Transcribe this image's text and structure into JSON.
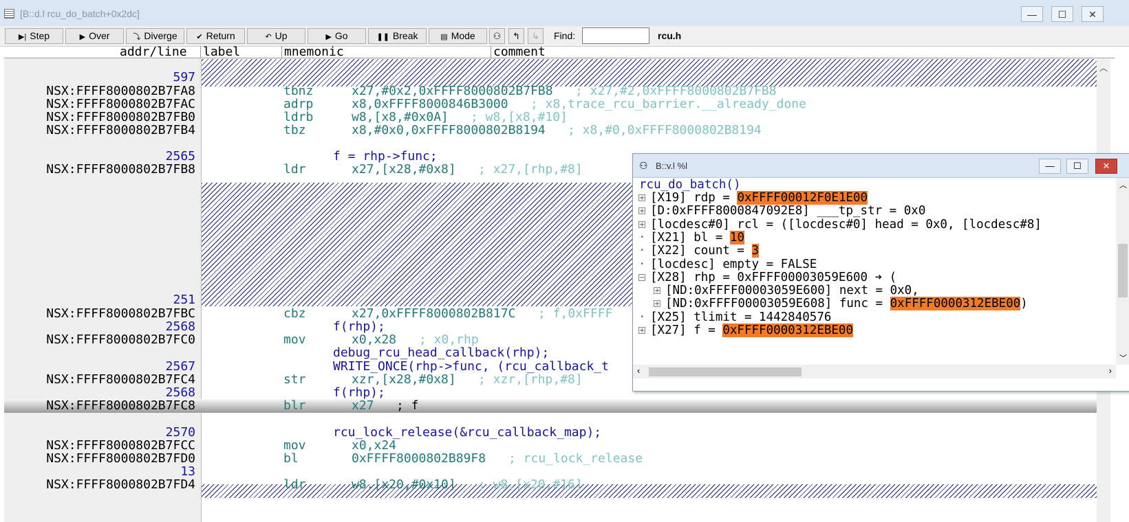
{
  "window": {
    "title": "[B::d.l rcu_do_batch+0x2dc]"
  },
  "toolbar": {
    "buttons": [
      {
        "icon": "▶|",
        "label": "Step"
      },
      {
        "icon": "▶",
        "label": "Over"
      },
      {
        "icon": "⤵",
        "label": "Diverge"
      },
      {
        "icon": "✔",
        "label": "Return"
      },
      {
        "icon": "↶",
        "label": "Up"
      },
      {
        "icon": "▶",
        "label": "Go"
      },
      {
        "icon": "❚❚",
        "label": "Break"
      },
      {
        "icon": "",
        "label": "Mode"
      }
    ],
    "find_label": "Find:",
    "find_value": "",
    "file": "rcu.h"
  },
  "columns": {
    "addr": "addr/line",
    "label": "label",
    "mnemonic": "mnemonic",
    "comment": "comment"
  },
  "listing": [
    {
      "kind": "line",
      "addr": "597"
    },
    {
      "kind": "ins",
      "addr": "NSX:FFFF8000802B7FA8",
      "mnem": "tbnz",
      "ops": "x27,#0x2,0xFFFF8000802B7FB8",
      "comment": "; x27,#2,0xFFFF8000802B7FB8"
    },
    {
      "kind": "ins",
      "addr": "NSX:FFFF8000802B7FAC",
      "mnem": "adrp",
      "ops": "x8,0xFFFF8000846B3000",
      "comment": "; x8,trace_rcu_barrier.__already_done"
    },
    {
      "kind": "ins",
      "addr": "NSX:FFFF8000802B7FB0",
      "mnem": "ldrb",
      "ops": "w8,[x8,#0x0A]",
      "comment": "; w8,[x8,#10]"
    },
    {
      "kind": "ins",
      "addr": "NSX:FFFF8000802B7FB4",
      "mnem": "tbz",
      "ops": "x8,#0x0,0xFFFF8000802B8194",
      "comment": "; x8,#0,0xFFFF8000802B8194"
    },
    {
      "kind": "line",
      "addr": "2565",
      "src": "f = rhp->func;"
    },
    {
      "kind": "ins",
      "addr": "NSX:FFFF8000802B7FB8",
      "mnem": "ldr",
      "ops": "x27,[x28,#0x8]",
      "comment": "; x27,[rhp,#8]"
    },
    {
      "kind": "line",
      "addr": "251"
    },
    {
      "kind": "ins",
      "addr": "NSX:FFFF8000802B7FBC",
      "mnem": "cbz",
      "ops": "x27,0xFFFF8000802B817C",
      "comment": "; f,0xFFFF"
    },
    {
      "kind": "line",
      "addr": "2568",
      "src": "f(rhp);"
    },
    {
      "kind": "ins",
      "addr": "NSX:FFFF8000802B7FC0",
      "mnem": "mov",
      "ops": "x0,x28",
      "comment": "; x0,rhp"
    },
    {
      "kind": "src",
      "src": "debug_rcu_head_callback(rhp);"
    },
    {
      "kind": "line",
      "addr": "2567",
      "src": "WRITE_ONCE(rhp->func, (rcu_callback_t"
    },
    {
      "kind": "ins",
      "addr": "NSX:FFFF8000802B7FC4",
      "mnem": "str",
      "ops": "xzr,[x28,#0x8]",
      "comment": "; xzr,[rhp,#8]"
    },
    {
      "kind": "line",
      "addr": "2568",
      "src": "f(rhp);"
    },
    {
      "kind": "ins",
      "addr": "NSX:FFFF8000802B7FC8",
      "mnem": "blr",
      "ops": "x27",
      "comment": "; f",
      "highlight": true
    },
    {
      "kind": "line",
      "addr": "2570",
      "src": "rcu_lock_release(&rcu_callback_map);"
    },
    {
      "kind": "ins",
      "addr": "NSX:FFFF8000802B7FCC",
      "mnem": "mov",
      "ops": "x0,x24",
      "comment": ""
    },
    {
      "kind": "ins",
      "addr": "NSX:FFFF8000802B7FD0",
      "mnem": "bl",
      "ops": "0xFFFF8000802B89F8",
      "comment": "; rcu_lock_release"
    },
    {
      "kind": "line",
      "addr": "13"
    },
    {
      "kind": "ins",
      "addr": "NSX:FFFF8000802B7FD4",
      "mnem": "ldr",
      "ops": "w8,[x20,#0x10]",
      "comment": "; w8,[x20,#16]"
    }
  ],
  "var_window": {
    "title": "B::v.l %l",
    "func": "rcu_do_batch()",
    "lines": [
      {
        "marker": "+",
        "text": "[X19] rdp = ",
        "value": "0xFFFF00012F0E1E00"
      },
      {
        "marker": "+",
        "text": "[D:0xFFFF8000847092E8] ___tp_str = 0x0",
        "value": ""
      },
      {
        "marker": "+",
        "text": "[locdesc#0] rcl = ([locdesc#0] head = 0x0, [locdesc#8]",
        "value": ""
      },
      {
        "marker": "·",
        "text": "[X21] bl = ",
        "value": "10"
      },
      {
        "marker": "·",
        "text": "[X22] count = ",
        "value": "3"
      },
      {
        "marker": "·",
        "text": "[locdesc] empty = FALSE",
        "value": ""
      },
      {
        "marker": "−",
        "text": "[X28] rhp = 0xFFFF00003059E600 ➔ (",
        "value": ""
      },
      {
        "marker": "+",
        "indent": true,
        "text": "[ND:0xFFFF00003059E600] next = 0x0,",
        "value": ""
      },
      {
        "marker": "+",
        "indent": true,
        "text": "[ND:0xFFFF00003059E608] func = ",
        "value": "0xFFFF0000312EBE00",
        "suffix": ")"
      },
      {
        "marker": "·",
        "text": "[X25] tlimit = 1442840576",
        "value": ""
      },
      {
        "marker": "+",
        "text": "[X27] f = ",
        "value": "0xFFFF0000312EBE00"
      }
    ]
  },
  "colors": {
    "highlight": "#f57a26",
    "code": "#1f7a7a",
    "comment": "#7fc3c3",
    "source": "#1515a3"
  }
}
